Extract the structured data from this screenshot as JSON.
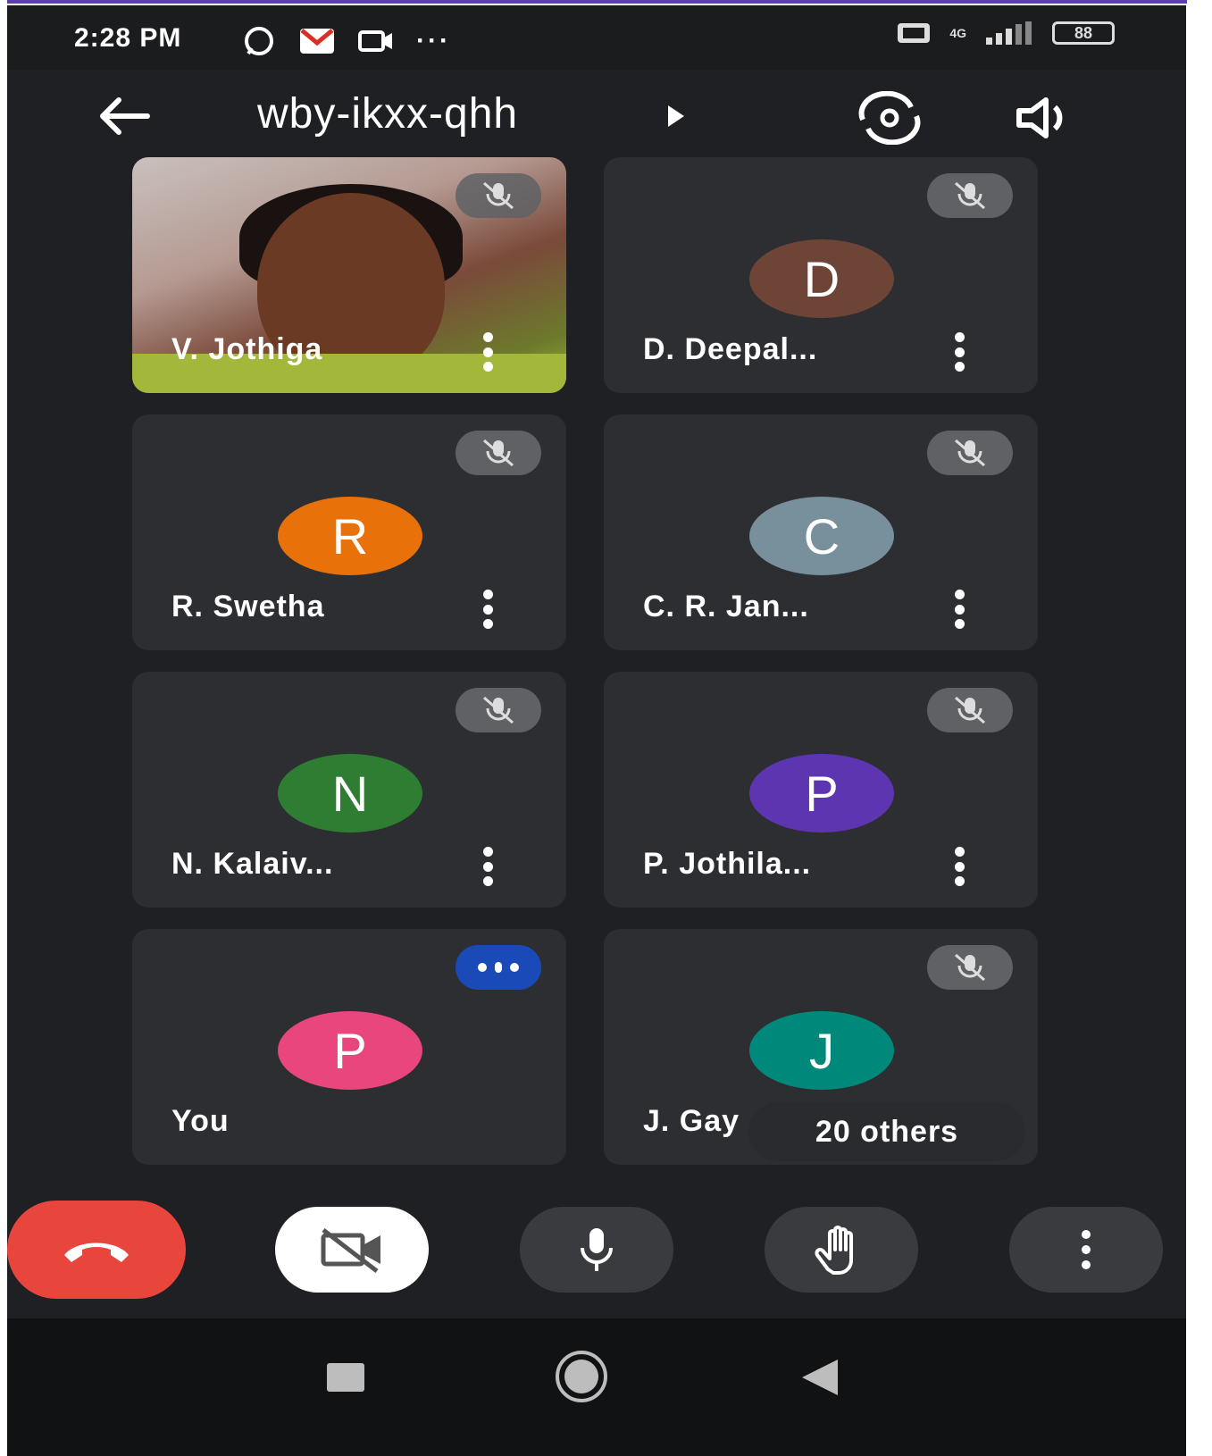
{
  "status_bar": {
    "time": "2:28 PM",
    "network": "4G",
    "battery": "88"
  },
  "header": {
    "meeting_code": "wby-ikxx-qhh"
  },
  "participants": [
    {
      "name": "V. Jothiga",
      "initial": "",
      "color": ""
    },
    {
      "name": "D. Deepal...",
      "initial": "D",
      "color": "#6e4437"
    },
    {
      "name": "R. Swetha",
      "initial": "R",
      "color": "#e8710a"
    },
    {
      "name": "C. R. Jan...",
      "initial": "C",
      "color": "#78909c"
    },
    {
      "name": "N. Kalaiv...",
      "initial": "N",
      "color": "#2e7d32"
    },
    {
      "name": "P. Jothila...",
      "initial": "P",
      "color": "#5e35b1"
    },
    {
      "name": "You",
      "initial": "P",
      "color": "#e8467c"
    },
    {
      "name": "J. Gay",
      "initial": "J",
      "color": "#00897b"
    }
  ],
  "others_pill": "20 others",
  "colors": {
    "end_call": "#e8453c",
    "tile_bg": "#2d2e31",
    "background": "#1f2023",
    "speaking": "#1a4ab8"
  }
}
